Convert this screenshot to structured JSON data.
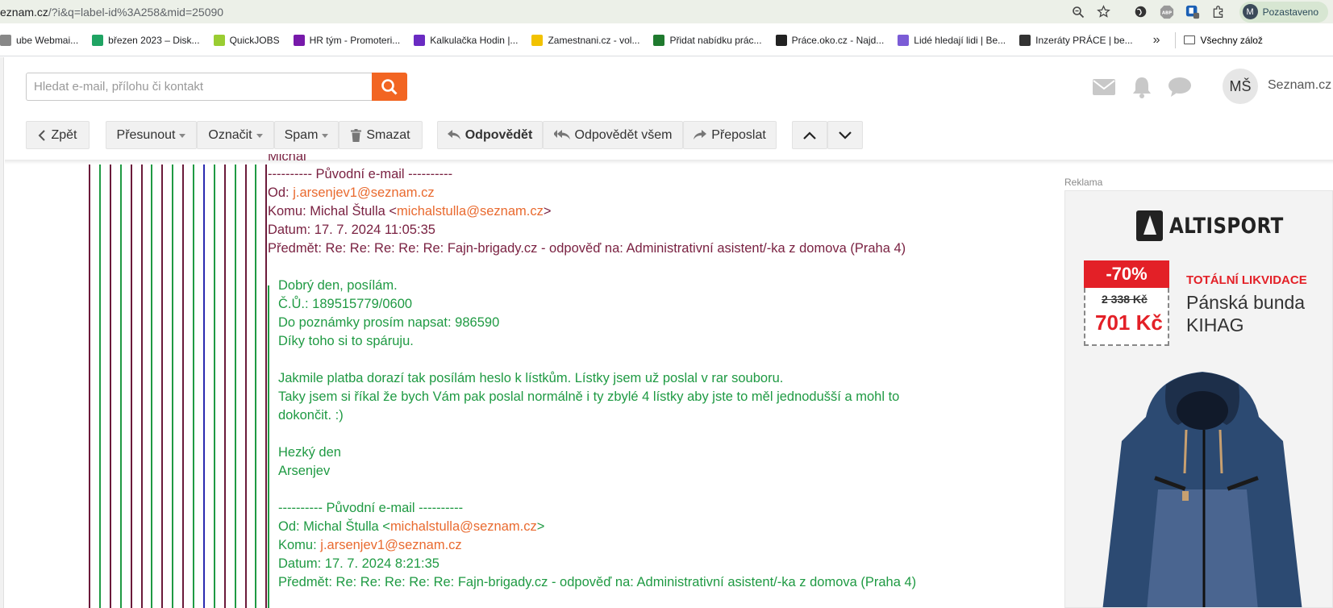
{
  "browser": {
    "url_host": "eznam.cz",
    "url_path": "/?i&q=label-id%3A258&mid=25090",
    "profile_initial": "M",
    "profile_label": "Pozastaveno"
  },
  "bookmarks": {
    "items": [
      {
        "label": "ube Webmai...",
        "icon": "webmail-icon",
        "color": "#888888"
      },
      {
        "label": "březen 2023 – Disk...",
        "icon": "google-drive-icon",
        "color": "#1fa463"
      },
      {
        "label": "QuickJOBS",
        "icon": "quickjobs-icon",
        "color": "#9acd32"
      },
      {
        "label": "HR tým - Promoteri...",
        "icon": "onenote-icon",
        "color": "#7719aa"
      },
      {
        "label": "Kalkulačka Hodin |...",
        "icon": "kalkulacka-icon",
        "color": "#6a2bc2"
      },
      {
        "label": "Zamestnani.cz - vol...",
        "icon": "zamestnani-icon",
        "color": "#f2c200"
      },
      {
        "label": "Přidat nabídku prác...",
        "icon": "pridat-icon",
        "color": "#1f7a2e"
      },
      {
        "label": "Práce.oko.cz - Najd...",
        "icon": "oko-icon",
        "color": "#222222"
      },
      {
        "label": "Lidé hledají lidi | Be...",
        "icon": "bpn-icon",
        "color": "#7b5cd6"
      },
      {
        "label": "Inzeráty PRÁCE | be...",
        "icon": "globe-icon",
        "color": "#333333"
      }
    ],
    "more": "»",
    "folder_label": "Všechny zálož"
  },
  "header": {
    "search_placeholder": "Hledat e-mail, přílohu či kontakt",
    "avatar_initials": "MŠ",
    "account": "Seznam.cz"
  },
  "toolbar": {
    "back": "Zpět",
    "move": "Přesunout",
    "mark": "Označit",
    "spam": "Spam",
    "delete": "Smazat",
    "reply": "Odpovědět",
    "reply_all": "Odpovědět všem",
    "forward": "Přeposlat"
  },
  "mail": {
    "cut_name": "Michal",
    "block1": {
      "separator": "---------- Původní e-mail ----------",
      "from_label": "Od: ",
      "from_email": "j.arsenjev1@seznam.cz",
      "to_label": "Komu: Michal Štulla <",
      "to_email": "michalstulla@seznam.cz",
      "to_close": ">",
      "date": "Datum: 17. 7. 2024 11:05:35",
      "subject": "Předmět: Re: Re: Re: Re: Re: Fajn-brigady.cz - odpověď na: Administrativní asistent/-ka z domova (Praha 4)"
    },
    "block2": {
      "lines": [
        "Dobrý den, posílám.",
        "Č.Ů.: 189515779/0600",
        "Do poznámky prosím napsat: 986590",
        "Díky toho si to spáruju."
      ],
      "para2": [
        "Jakmile platba dorazí tak posílám heslo k lístkům. Lístky jsem už poslal v rar souboru.",
        "Taky jsem si říkal že bych Vám pak poslal normálně i ty zbylé 4 lístky aby jste to měl jednodušší a mohl to",
        "dokončit. :)"
      ],
      "sign": [
        "Hezký den",
        "Arsenjev"
      ],
      "separator": "---------- Původní e-mail ----------",
      "from_label": "Od: Michal Štulla <",
      "from_email": "michalstulla@seznam.cz",
      "from_close": ">",
      "to_label": "Komu: ",
      "to_email": "j.arsenjev1@seznam.cz",
      "date": "Datum: 17. 7. 2024 8:21:35",
      "subject": "Předmět: Re: Re: Re: Re: Re: Fajn-brigady.cz - odpověď na: Administrativní asistent/-ka z domova (Praha 4)"
    }
  },
  "quote_line_colors": [
    "#6b1a3a",
    "#1f9a43",
    "#6b1a3a",
    "#1f9a43",
    "#6b1a3a",
    "#6b1a3a",
    "#1f9a43",
    "#6b1a3a",
    "#1f9a43",
    "#6b1a3a",
    "#1f9a43",
    "#2b2bb0",
    "#1f9a43",
    "#6b1a3a",
    "#1f9a43",
    "#6b1a3a",
    "#1f9a43",
    "#6b1a3a"
  ],
  "ad": {
    "label": "Reklama",
    "brand": "ALTISPORT",
    "discount": "-70%",
    "old_price": "2 338 Kč",
    "new_price": "701 Kč",
    "headline": "TOTÁLNÍ LIKVIDACE",
    "product_line1": "Pánská bunda",
    "product_line2": "KIHAG"
  },
  "colors": {
    "accent": "#f26522",
    "maroon": "#7a2242",
    "green": "#1f9a43",
    "link": "#e96a2f"
  }
}
